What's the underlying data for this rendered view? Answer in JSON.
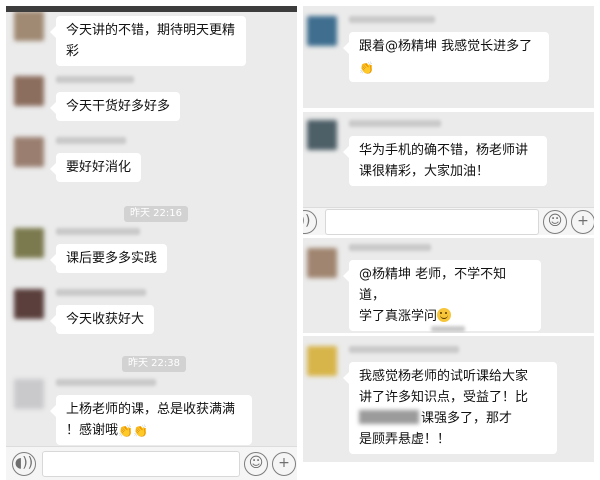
{
  "left_panel": {
    "messages": [
      {
        "lines": [
          "今天讲的不错，期待明天更精",
          "彩"
        ]
      },
      {
        "lines": [
          "今天干货好多好多"
        ]
      },
      {
        "lines": [
          "要好好消化"
        ]
      },
      {
        "lines": [
          "课后要多多实践"
        ]
      },
      {
        "lines": [
          "今天收获好大"
        ]
      },
      {
        "lines": [
          "上杨老师的课，总是收获满满",
          "！感谢哦"
        ]
      }
    ],
    "timestamps": [
      "昨天 22:16",
      "昨天 22:38"
    ],
    "emoji": "👏👏"
  },
  "right_panel": {
    "messages": [
      {
        "lines": [
          "跟着@杨精坤 我感觉长进多了"
        ]
      },
      {
        "lines": [
          "华为手机的确不错，杨老师讲",
          "课很精彩，大家加油！"
        ]
      },
      {
        "lines": [
          "@杨精坤 老师，不学不知道，",
          "学了真涨学问"
        ]
      },
      {
        "lines": [
          "我感觉杨老师的试听课给大家",
          "讲了许多知识点，受益了！比",
          "课强多了，那才",
          "是顾弄悬虚！！"
        ]
      }
    ],
    "emoji": "👏"
  },
  "icons": {
    "voice": "voice-icon",
    "emoji_button": "smiley-icon",
    "add": "plus-icon"
  },
  "colors": {
    "chat_background": "#ebebeb",
    "bubble": "#ffffff",
    "timestamp_pill": "#d2d2d2"
  }
}
